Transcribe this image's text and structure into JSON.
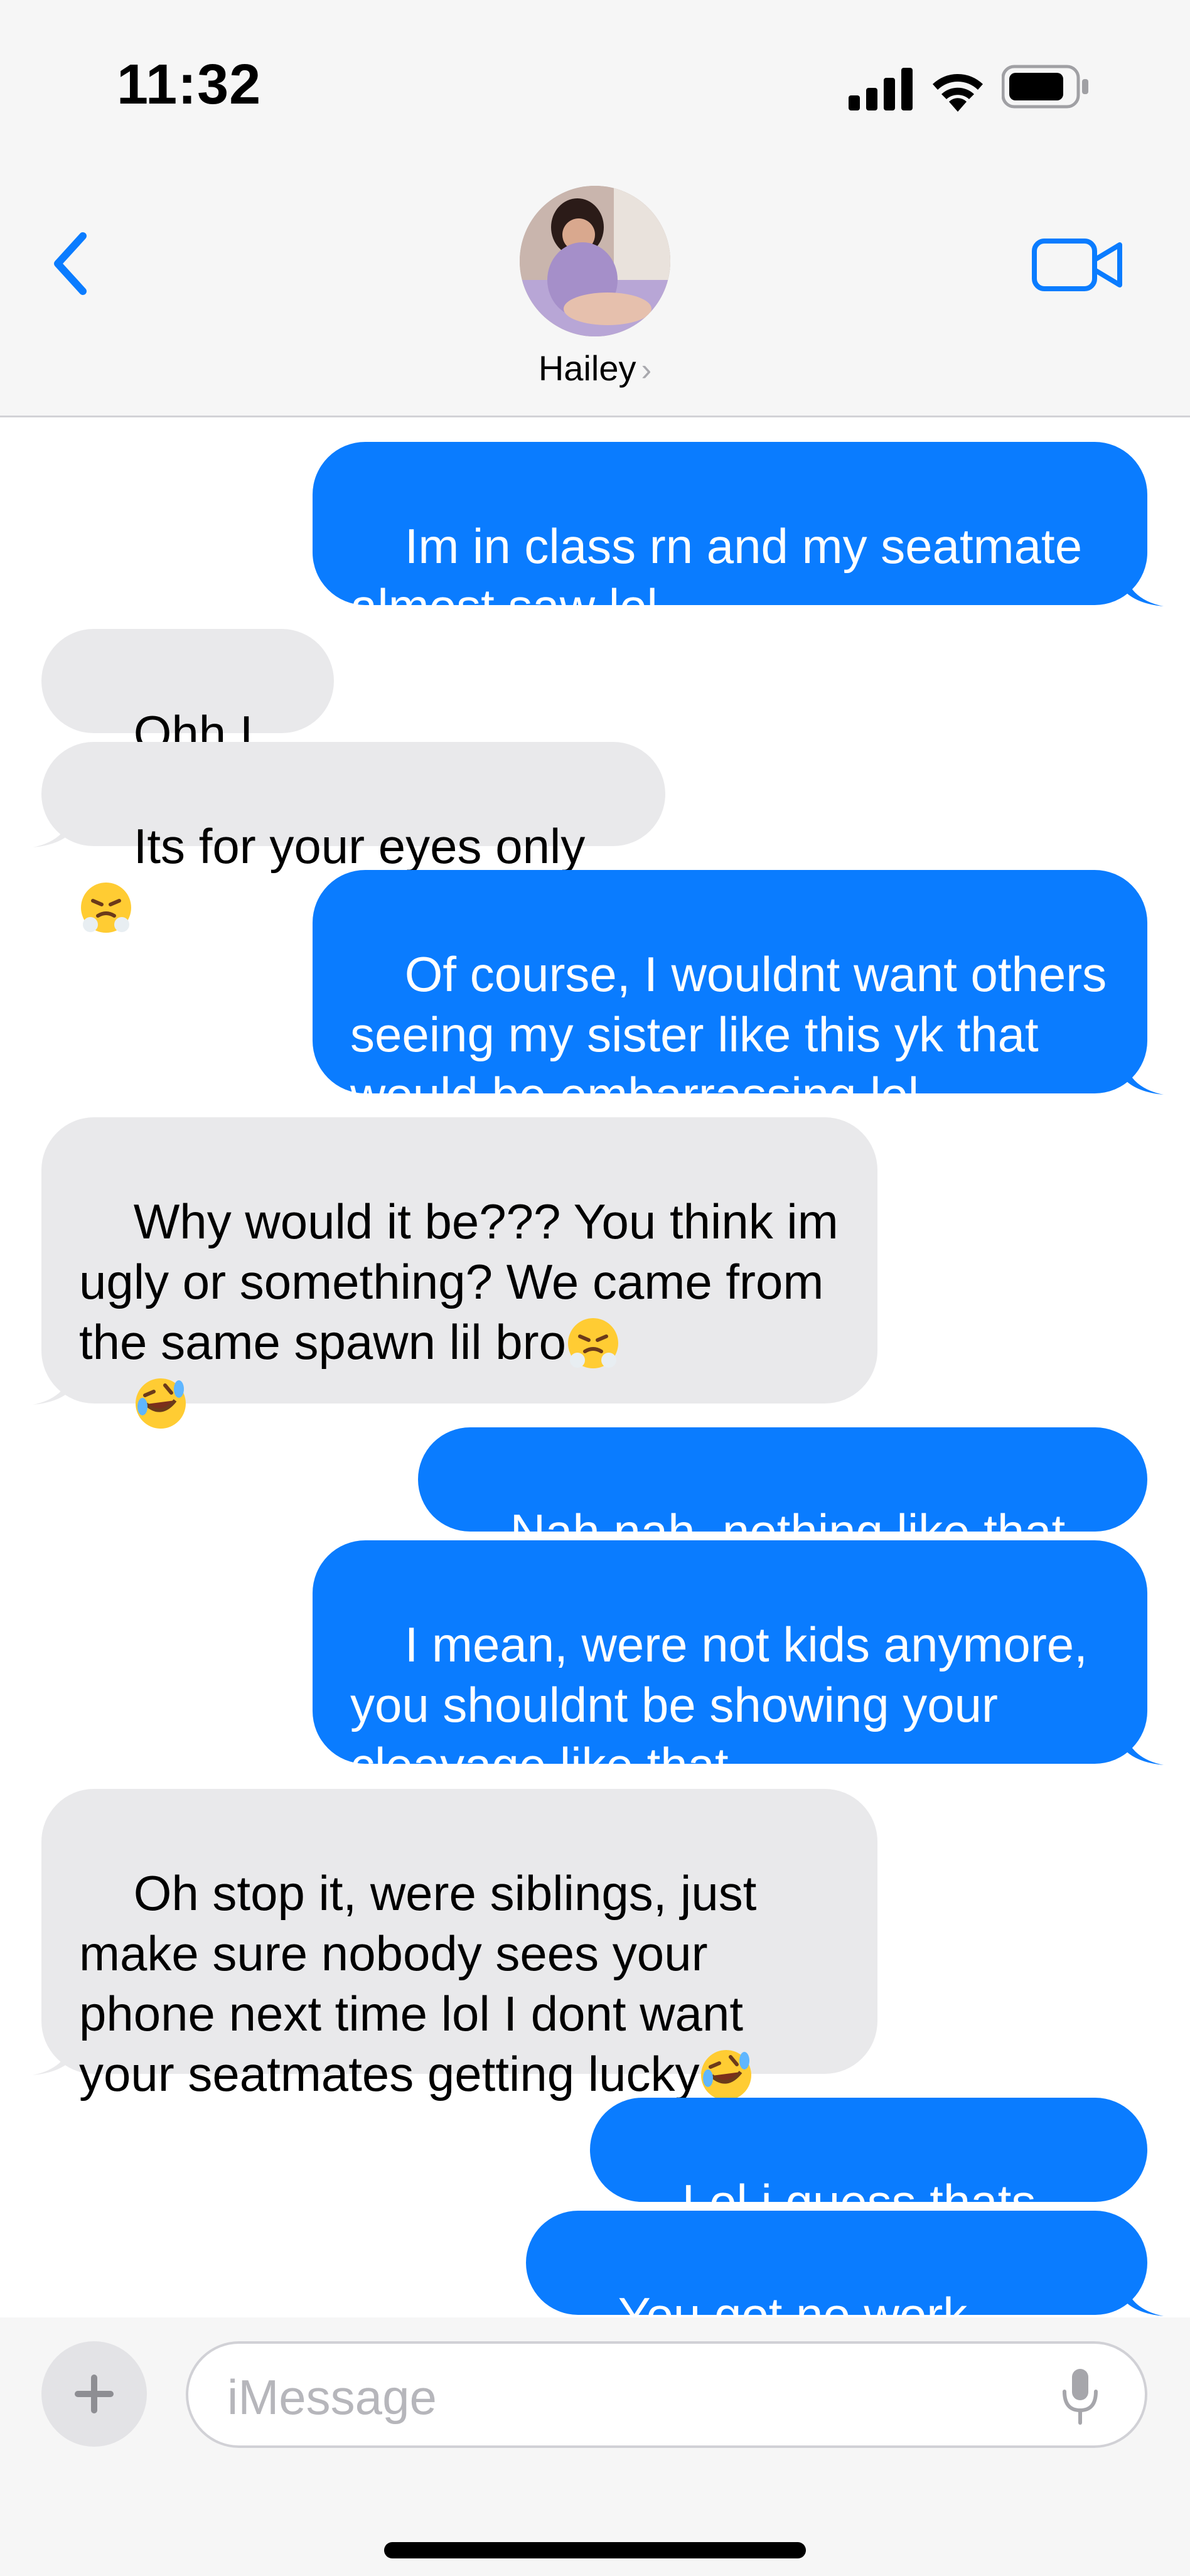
{
  "status_bar": {
    "time": "11:32"
  },
  "header": {
    "contact_name": "Hailey",
    "chevron": "›",
    "icons": {
      "back": "chevron-left-icon",
      "video": "video-camera-icon"
    },
    "accent_color": "#0a7cff"
  },
  "messages": [
    {
      "from": "me",
      "text": "Im in class rn and my seatmate almost saw lol"
    },
    {
      "from": "them",
      "text": "Ohh I see"
    },
    {
      "from": "them",
      "text": "Its for your eyes only",
      "emoji": "face-with-steam-icon"
    },
    {
      "from": "me",
      "text": "Of course, I wouldnt want others seeing my sister like this yk that would be embarrassing lol"
    },
    {
      "from": "them",
      "text": "Why would it be??? You think im ugly or something? We came from the same spawn lil bro",
      "emoji": [
        "face-with-steam-icon",
        "rolling-laughing-icon"
      ]
    },
    {
      "from": "me",
      "text": "Nah nah, nothing like that lol"
    },
    {
      "from": "me",
      "text": "I mean, were not kids anymore, you shouldnt be showing your cleavage like that"
    },
    {
      "from": "them",
      "text": "Oh stop it, were siblings, just make sure nobody sees your phone next time lol I dont want your seatmates getting lucky",
      "emoji": "rolling-laughing-icon"
    },
    {
      "from": "me",
      "text": "Lol i guess thats true"
    },
    {
      "from": "me",
      "text": "You got no work today?"
    }
  ],
  "composer": {
    "placeholder": "iMessage",
    "plus_icon": "plus-icon",
    "mic_icon": "microphone-icon"
  },
  "colors": {
    "outgoing_bubble": "#0a7cff",
    "incoming_bubble": "#e9e9eb",
    "header_bg": "#f6f6f6"
  }
}
